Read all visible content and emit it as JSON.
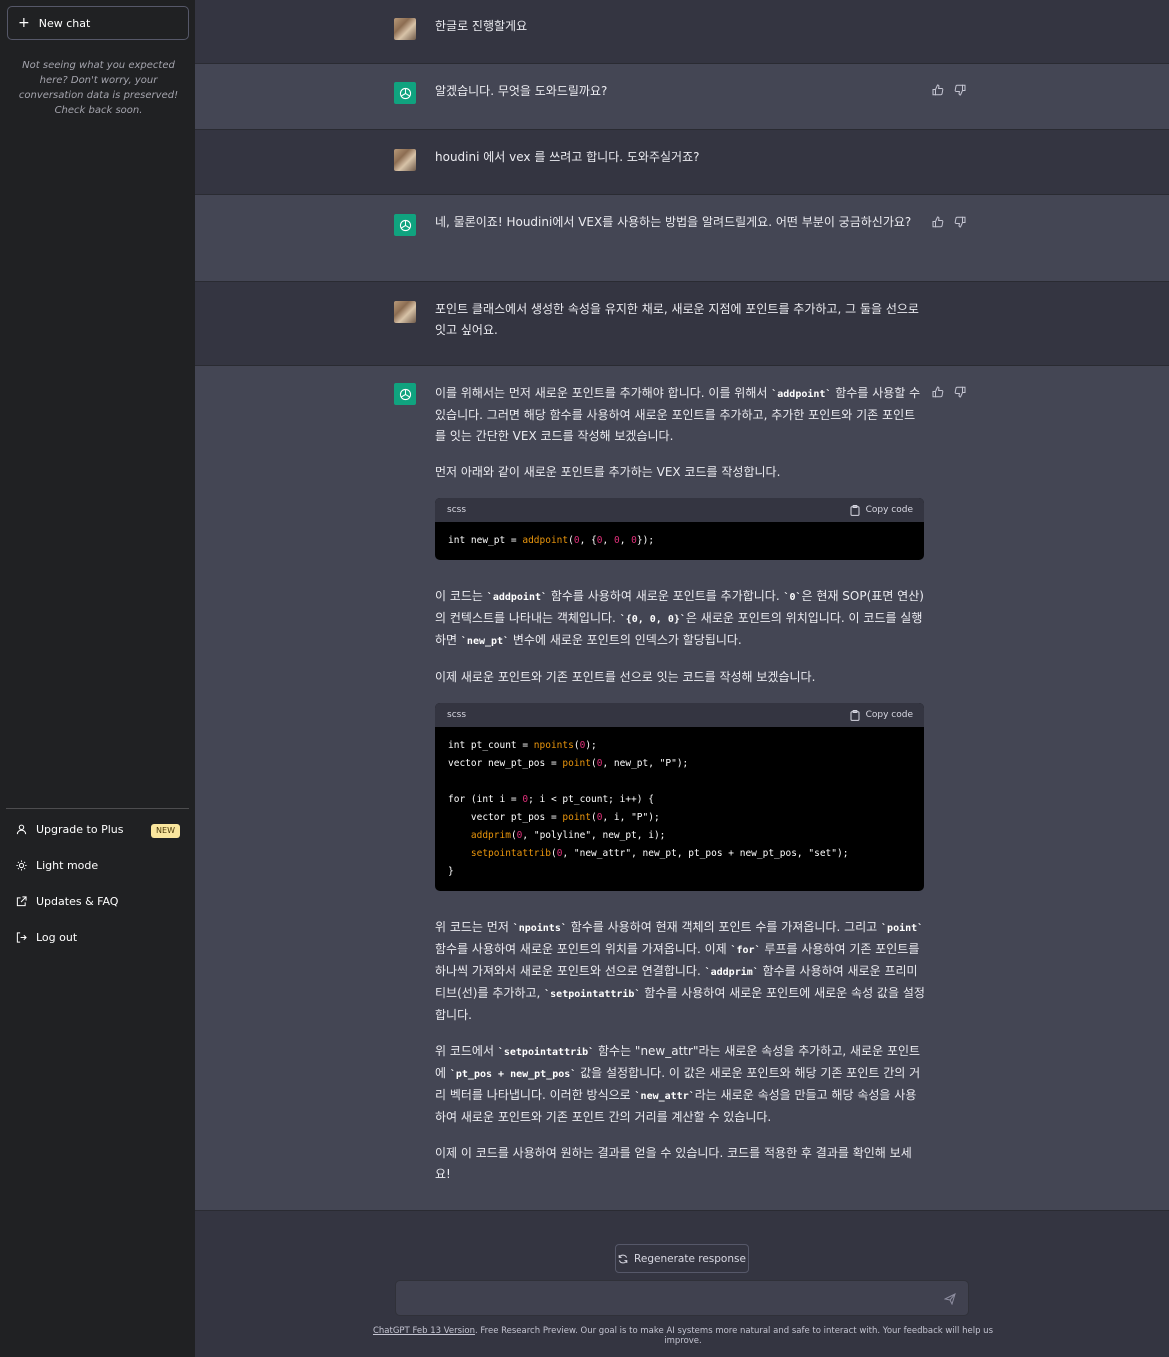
{
  "sidebar": {
    "new_chat": "New chat",
    "notice": "Not seeing what you expected here? Don't worry, your conversation data is preserved! Check back soon.",
    "menu": [
      {
        "label": "Upgrade to Plus",
        "badge": "NEW"
      },
      {
        "label": "Light mode"
      },
      {
        "label": "Updates & FAQ"
      },
      {
        "label": "Log out"
      }
    ]
  },
  "messages": {
    "m1": "한글로 진행할게요",
    "m2": "알겠습니다. 무엇을 도와드릴까요?",
    "m3": "houdini 에서 vex 를 쓰려고 합니다. 도와주실거죠?",
    "m4": "네, 물론이죠! Houdini에서 VEX를 사용하는 방법을 알려드릴게요. 어떤 부분이 궁금하신가요?",
    "m5": "포인트 클래스에서 생성한 속성을 유지한 채로, 새로운 지점에 포인트를 추가하고, 그 둘을 선으로 잇고 싶어요.",
    "m6": {
      "p1_a": "이를 위해서는 먼저 새로운 포인트를 추가해야 합니다. 이를 위해서 ",
      "p1_code": "`addpoint`",
      "p1_b": " 함수를 사용할 수 있습니다. 그러면 해당 함수를 사용하여 새로운 포인트를 추가하고, 추가한 포인트와 기존 포인트를 잇는 간단한 VEX 코드를 작성해 보겠습니다.",
      "p2": "먼저 아래와 같이 새로운 포인트를 추가하는 VEX 코드를 작성합니다.",
      "code1_lang": "scss",
      "copy_label": "Copy code",
      "p3_a": "이 코드는 ",
      "p3_c1": "`addpoint`",
      "p3_b": " 함수를 사용하여 새로운 포인트를 추가합니다. ",
      "p3_c2": "`0`",
      "p3_c": "은 현재 SOP(표면 연산)의 컨텍스트를 나타내는 객체입니다. ",
      "p3_c3": "`{0, 0, 0}`",
      "p3_d": "은 새로운 포인트의 위치입니다. 이 코드를 실행하면 ",
      "p3_c4": "`new_pt`",
      "p3_e": " 변수에 새로운 포인트의 인덱스가 할당됩니다.",
      "p4": "이제 새로운 포인트와 기존 포인트를 선으로 잇는 코드를 작성해 보겠습니다.",
      "code2_lang": "scss",
      "p5_a": "위 코드는 먼저 ",
      "p5_c1": "`npoints`",
      "p5_b": " 함수를 사용하여 현재 객체의 포인트 수를 가져옵니다. 그리고 ",
      "p5_c2": "`point`",
      "p5_c": " 함수를 사용하여 새로운 포인트의 위치를 가져옵니다. 이제 ",
      "p5_c3": "`for`",
      "p5_d": " 루프를 사용하여 기존 포인트를 하나씩 가져와서 새로운 포인트와 선으로 연결합니다. ",
      "p5_c4": "`addprim`",
      "p5_e": " 함수를 사용하여 새로운 프리미티브(선)를 추가하고, ",
      "p5_c5": "`setpointattrib`",
      "p5_f": " 함수를 사용하여 새로운 포인트에 새로운 속성 값을 설정합니다.",
      "p6_a": "위 코드에서 ",
      "p6_c1": "`setpointattrib`",
      "p6_b": " 함수는 \"new_attr\"라는 새로운 속성을 추가하고, 새로운 포인트에 ",
      "p6_c2": "`pt_pos + new_pt_pos`",
      "p6_c": " 값을 설정합니다. 이 값은 새로운 포인트와 해당 기존 포인트 간의 거리 벡터를 나타냅니다. 이러한 방식으로 ",
      "p6_c3": "`new_attr`",
      "p6_d": "라는 새로운 속성을 만들고 해당 속성을 사용하여 새로운 포인트와 기존 포인트 간의 거리를 계산할 수 있습니다.",
      "p7": "이제 이 코드를 사용하여 원하는 결과를 얻을 수 있습니다. 코드를 적용한 후 결과를 확인해 보세요!"
    }
  },
  "regenerate": "Regenerate response",
  "input": {
    "placeholder": "",
    "value": ""
  },
  "footer": {
    "link": "ChatGPT Feb 13 Version",
    "text": ". Free Research Preview. Our goal is to make AI systems more natural and safe to interact with. Your feedback will help us improve."
  },
  "colors": {
    "accent": "#10a37f",
    "sidebar": "#202123",
    "user_row": "#343541",
    "bot_row": "#444654"
  }
}
